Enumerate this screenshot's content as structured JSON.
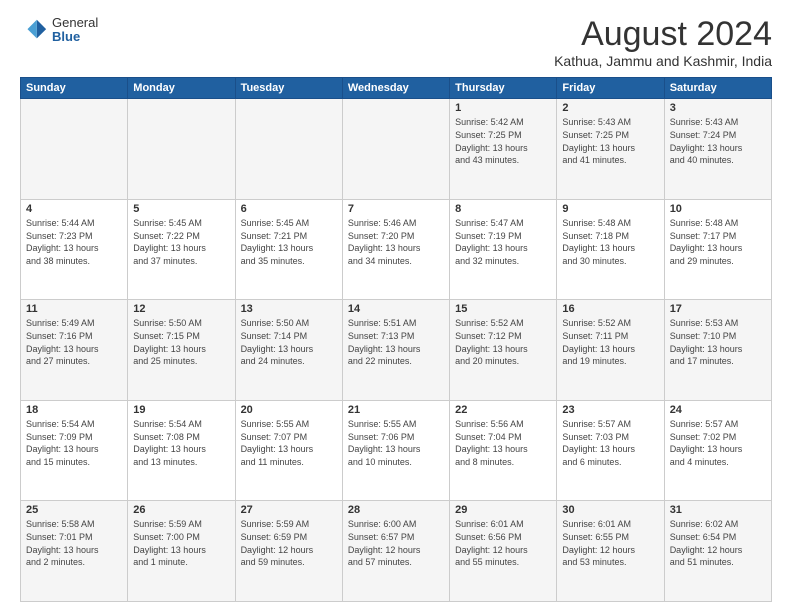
{
  "logo": {
    "general": "General",
    "blue": "Blue"
  },
  "title": "August 2024",
  "subtitle": "Kathua, Jammu and Kashmir, India",
  "days_of_week": [
    "Sunday",
    "Monday",
    "Tuesday",
    "Wednesday",
    "Thursday",
    "Friday",
    "Saturday"
  ],
  "weeks": [
    [
      {
        "day": "",
        "info": ""
      },
      {
        "day": "",
        "info": ""
      },
      {
        "day": "",
        "info": ""
      },
      {
        "day": "",
        "info": ""
      },
      {
        "day": "1",
        "info": "Sunrise: 5:42 AM\nSunset: 7:25 PM\nDaylight: 13 hours\nand 43 minutes."
      },
      {
        "day": "2",
        "info": "Sunrise: 5:43 AM\nSunset: 7:25 PM\nDaylight: 13 hours\nand 41 minutes."
      },
      {
        "day": "3",
        "info": "Sunrise: 5:43 AM\nSunset: 7:24 PM\nDaylight: 13 hours\nand 40 minutes."
      }
    ],
    [
      {
        "day": "4",
        "info": "Sunrise: 5:44 AM\nSunset: 7:23 PM\nDaylight: 13 hours\nand 38 minutes."
      },
      {
        "day": "5",
        "info": "Sunrise: 5:45 AM\nSunset: 7:22 PM\nDaylight: 13 hours\nand 37 minutes."
      },
      {
        "day": "6",
        "info": "Sunrise: 5:45 AM\nSunset: 7:21 PM\nDaylight: 13 hours\nand 35 minutes."
      },
      {
        "day": "7",
        "info": "Sunrise: 5:46 AM\nSunset: 7:20 PM\nDaylight: 13 hours\nand 34 minutes."
      },
      {
        "day": "8",
        "info": "Sunrise: 5:47 AM\nSunset: 7:19 PM\nDaylight: 13 hours\nand 32 minutes."
      },
      {
        "day": "9",
        "info": "Sunrise: 5:48 AM\nSunset: 7:18 PM\nDaylight: 13 hours\nand 30 minutes."
      },
      {
        "day": "10",
        "info": "Sunrise: 5:48 AM\nSunset: 7:17 PM\nDaylight: 13 hours\nand 29 minutes."
      }
    ],
    [
      {
        "day": "11",
        "info": "Sunrise: 5:49 AM\nSunset: 7:16 PM\nDaylight: 13 hours\nand 27 minutes."
      },
      {
        "day": "12",
        "info": "Sunrise: 5:50 AM\nSunset: 7:15 PM\nDaylight: 13 hours\nand 25 minutes."
      },
      {
        "day": "13",
        "info": "Sunrise: 5:50 AM\nSunset: 7:14 PM\nDaylight: 13 hours\nand 24 minutes."
      },
      {
        "day": "14",
        "info": "Sunrise: 5:51 AM\nSunset: 7:13 PM\nDaylight: 13 hours\nand 22 minutes."
      },
      {
        "day": "15",
        "info": "Sunrise: 5:52 AM\nSunset: 7:12 PM\nDaylight: 13 hours\nand 20 minutes."
      },
      {
        "day": "16",
        "info": "Sunrise: 5:52 AM\nSunset: 7:11 PM\nDaylight: 13 hours\nand 19 minutes."
      },
      {
        "day": "17",
        "info": "Sunrise: 5:53 AM\nSunset: 7:10 PM\nDaylight: 13 hours\nand 17 minutes."
      }
    ],
    [
      {
        "day": "18",
        "info": "Sunrise: 5:54 AM\nSunset: 7:09 PM\nDaylight: 13 hours\nand 15 minutes."
      },
      {
        "day": "19",
        "info": "Sunrise: 5:54 AM\nSunset: 7:08 PM\nDaylight: 13 hours\nand 13 minutes."
      },
      {
        "day": "20",
        "info": "Sunrise: 5:55 AM\nSunset: 7:07 PM\nDaylight: 13 hours\nand 11 minutes."
      },
      {
        "day": "21",
        "info": "Sunrise: 5:55 AM\nSunset: 7:06 PM\nDaylight: 13 hours\nand 10 minutes."
      },
      {
        "day": "22",
        "info": "Sunrise: 5:56 AM\nSunset: 7:04 PM\nDaylight: 13 hours\nand 8 minutes."
      },
      {
        "day": "23",
        "info": "Sunrise: 5:57 AM\nSunset: 7:03 PM\nDaylight: 13 hours\nand 6 minutes."
      },
      {
        "day": "24",
        "info": "Sunrise: 5:57 AM\nSunset: 7:02 PM\nDaylight: 13 hours\nand 4 minutes."
      }
    ],
    [
      {
        "day": "25",
        "info": "Sunrise: 5:58 AM\nSunset: 7:01 PM\nDaylight: 13 hours\nand 2 minutes."
      },
      {
        "day": "26",
        "info": "Sunrise: 5:59 AM\nSunset: 7:00 PM\nDaylight: 13 hours\nand 1 minute."
      },
      {
        "day": "27",
        "info": "Sunrise: 5:59 AM\nSunset: 6:59 PM\nDaylight: 12 hours\nand 59 minutes."
      },
      {
        "day": "28",
        "info": "Sunrise: 6:00 AM\nSunset: 6:57 PM\nDaylight: 12 hours\nand 57 minutes."
      },
      {
        "day": "29",
        "info": "Sunrise: 6:01 AM\nSunset: 6:56 PM\nDaylight: 12 hours\nand 55 minutes."
      },
      {
        "day": "30",
        "info": "Sunrise: 6:01 AM\nSunset: 6:55 PM\nDaylight: 12 hours\nand 53 minutes."
      },
      {
        "day": "31",
        "info": "Sunrise: 6:02 AM\nSunset: 6:54 PM\nDaylight: 12 hours\nand 51 minutes."
      }
    ]
  ]
}
